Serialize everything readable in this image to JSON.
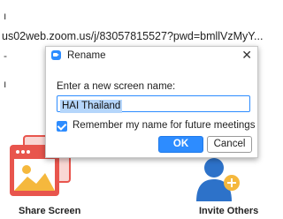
{
  "background": {
    "fragments": [
      "ı",
      "-",
      "ı"
    ],
    "url": "us02web.zoom.us/j/83057815527?pwd=bmllVzMyY...",
    "share_screen_label": "Share Screen",
    "invite_others_label": "Invite Others"
  },
  "dialog": {
    "title": "Rename",
    "close_glyph": "✕",
    "prompt": "Enter a new screen name:",
    "name_value": "HAI Thailand",
    "remember_label": "Remember my name for future meetings",
    "remember_checked": true,
    "ok_label": "OK",
    "cancel_label": "Cancel"
  },
  "colors": {
    "accent": "#2d8cff",
    "share_tile": "#e8554d",
    "share_sun": "#f5b83d"
  },
  "icons": [
    "zoom-app-icon",
    "close-icon",
    "checkbox-checked-icon",
    "share-screen-icon",
    "invite-others-icon"
  ]
}
